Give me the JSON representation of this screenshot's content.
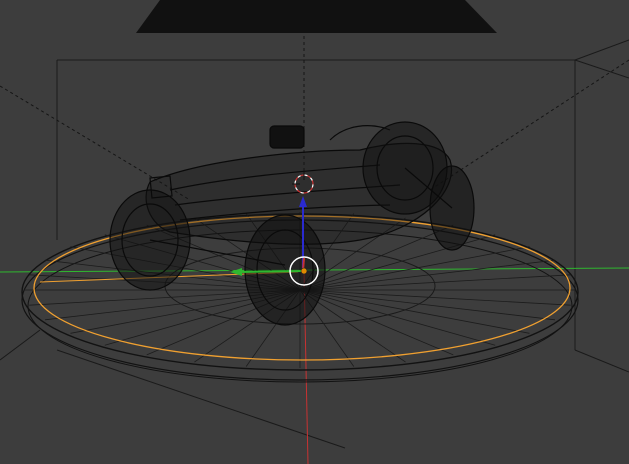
{
  "viewport": {
    "background": "#3d3d3d",
    "wire_color": "#000000",
    "selected_color": "#f0a030",
    "x_axis_color": "#2fb82f",
    "y_axis_color": "#c83232",
    "z_axis_color": "#2a2ad0",
    "gizmo_ring_color": "#ffffff",
    "object_origin_color": "#e08a00",
    "cursor_color": "#c83232",
    "icons": {
      "camera": "camera-icon",
      "cursor": "3d-cursor-icon",
      "gizmo": "transform-gizmo-icon",
      "origin": "object-origin-icon"
    }
  }
}
